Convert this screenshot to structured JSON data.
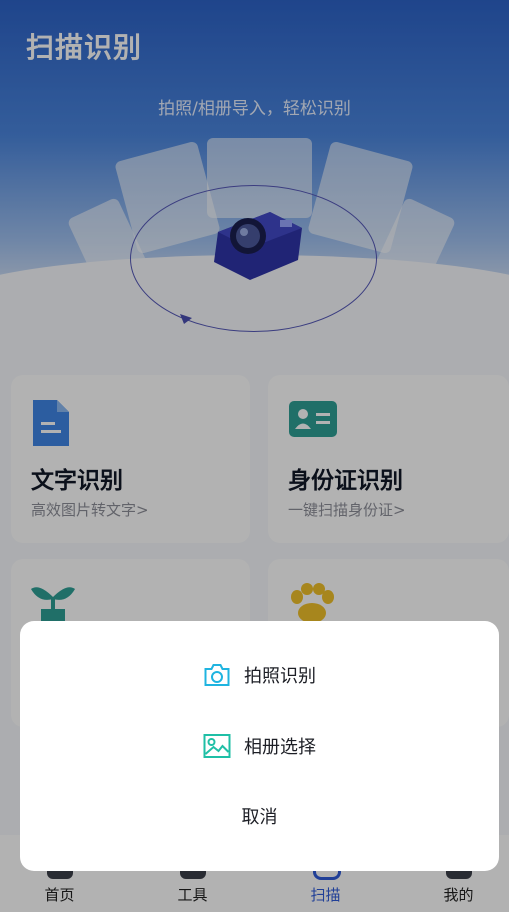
{
  "app": {
    "title": "扫描识别",
    "subtitle": "拍照/相册导入，轻松识别"
  },
  "features": [
    {
      "title": "文字识别",
      "desc": "高效图片转文字>",
      "icon": "document-icon",
      "color": "#3f86e6"
    },
    {
      "title": "身份证识别",
      "desc": "一键扫描身份证>",
      "icon": "id-card-icon",
      "color": "#2e9f96"
    },
    {
      "title": "",
      "desc": "",
      "icon": "plant-icon",
      "color": "#2e9f96"
    },
    {
      "title": "",
      "desc": "",
      "icon": "paw-icon",
      "color": "#f0c02a"
    }
  ],
  "tabbar": [
    {
      "label": "首页",
      "icon": "home-icon"
    },
    {
      "label": "工具",
      "icon": "tools-icon"
    },
    {
      "label": "扫描",
      "icon": "scan-icon",
      "active": true
    },
    {
      "label": "我的",
      "icon": "profile-icon"
    }
  ],
  "sheet": {
    "options": [
      {
        "label": "拍照识别",
        "icon": "camera-icon",
        "color": "#1fb4e0"
      },
      {
        "label": "相册选择",
        "icon": "image-icon",
        "color": "#1fbfa6"
      }
    ],
    "cancel": "取消"
  },
  "colors": {
    "accent": "#2f5bd9",
    "hero_top": "#2d63c8"
  }
}
